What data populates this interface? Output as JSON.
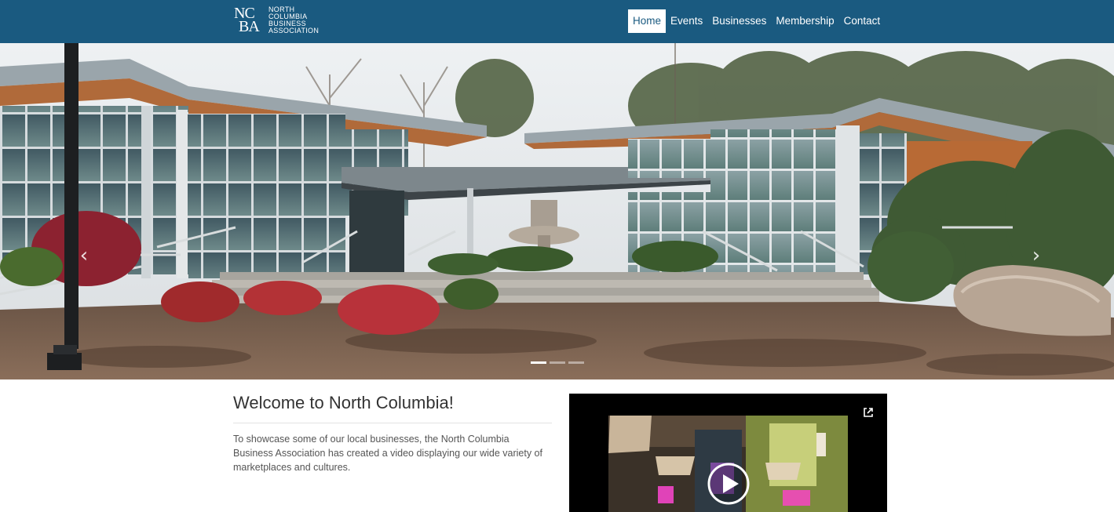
{
  "header": {
    "logo": {
      "monogram_top": "NC",
      "monogram_bottom": "BA",
      "lines": [
        "NORTH",
        "COLUMBIA",
        "BUSINESS",
        "ASSOCIATION"
      ]
    },
    "nav": [
      {
        "label": "Home",
        "active": true
      },
      {
        "label": "Events",
        "active": false
      },
      {
        "label": "Businesses",
        "active": false
      },
      {
        "label": "Membership",
        "active": false
      },
      {
        "label": "Contact",
        "active": false
      }
    ],
    "background_color": "#1a5a80"
  },
  "hero": {
    "prev_icon": "chevron-left-icon",
    "next_icon": "chevron-right-icon",
    "slides": 3,
    "active_slide": 1
  },
  "main": {
    "title": "Welcome to North Columbia!",
    "body": "To showcase some of our local businesses, the North Columbia Business Association has created a video displaying our wide variety of marketplaces and cultures."
  },
  "video": {
    "external_icon": "external-link-icon",
    "play_icon": "play-icon"
  }
}
